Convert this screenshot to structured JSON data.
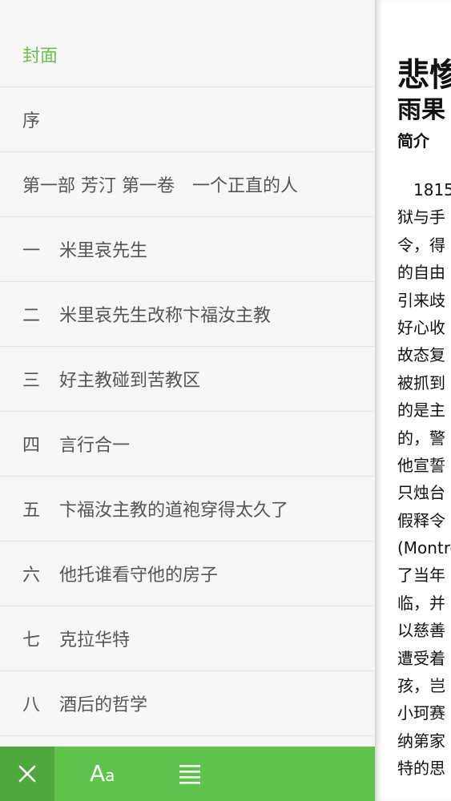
{
  "toc": {
    "items": [
      {
        "num": "",
        "label": "封面",
        "active": true
      },
      {
        "num": "",
        "label": "序"
      },
      {
        "num": "",
        "label": "第一部 芳汀 第一卷　一个正直的人"
      },
      {
        "num": "一",
        "label": "米里哀先生"
      },
      {
        "num": "二",
        "label": "米里哀先生改称卞福汝主教"
      },
      {
        "num": "三",
        "label": "好主教碰到苦教区"
      },
      {
        "num": "四",
        "label": "言行合一"
      },
      {
        "num": "五",
        "label": "卞福汝主教的道袍穿得太久了"
      },
      {
        "num": "六",
        "label": "他托谁看守他的房子"
      },
      {
        "num": "七",
        "label": "克拉华特"
      },
      {
        "num": "八",
        "label": "酒后的哲学"
      }
    ]
  },
  "toolbar": {
    "close_icon": "close-icon",
    "font_label_large": "A",
    "font_label_small": "a",
    "list_icon": "list-icon",
    "accent": "#5fc24a",
    "close_bg": "#4fa83d"
  },
  "reader": {
    "title": "悲惨",
    "author": "雨果",
    "intro": "简介",
    "lines": [
      "　1815",
      "狱与手",
      "令，得",
      "的自由",
      "引来歧",
      "好心收",
      "故态复",
      "被抓到",
      "的是主",
      "的，警",
      "他宣誓",
      "只烛台",
      "假释令",
      "(Montreuil",
      "了当年",
      "临，并",
      "以慈善",
      "遭受着",
      "孩，岂",
      "小珂赛",
      "纳第家",
      "特的思"
    ]
  }
}
